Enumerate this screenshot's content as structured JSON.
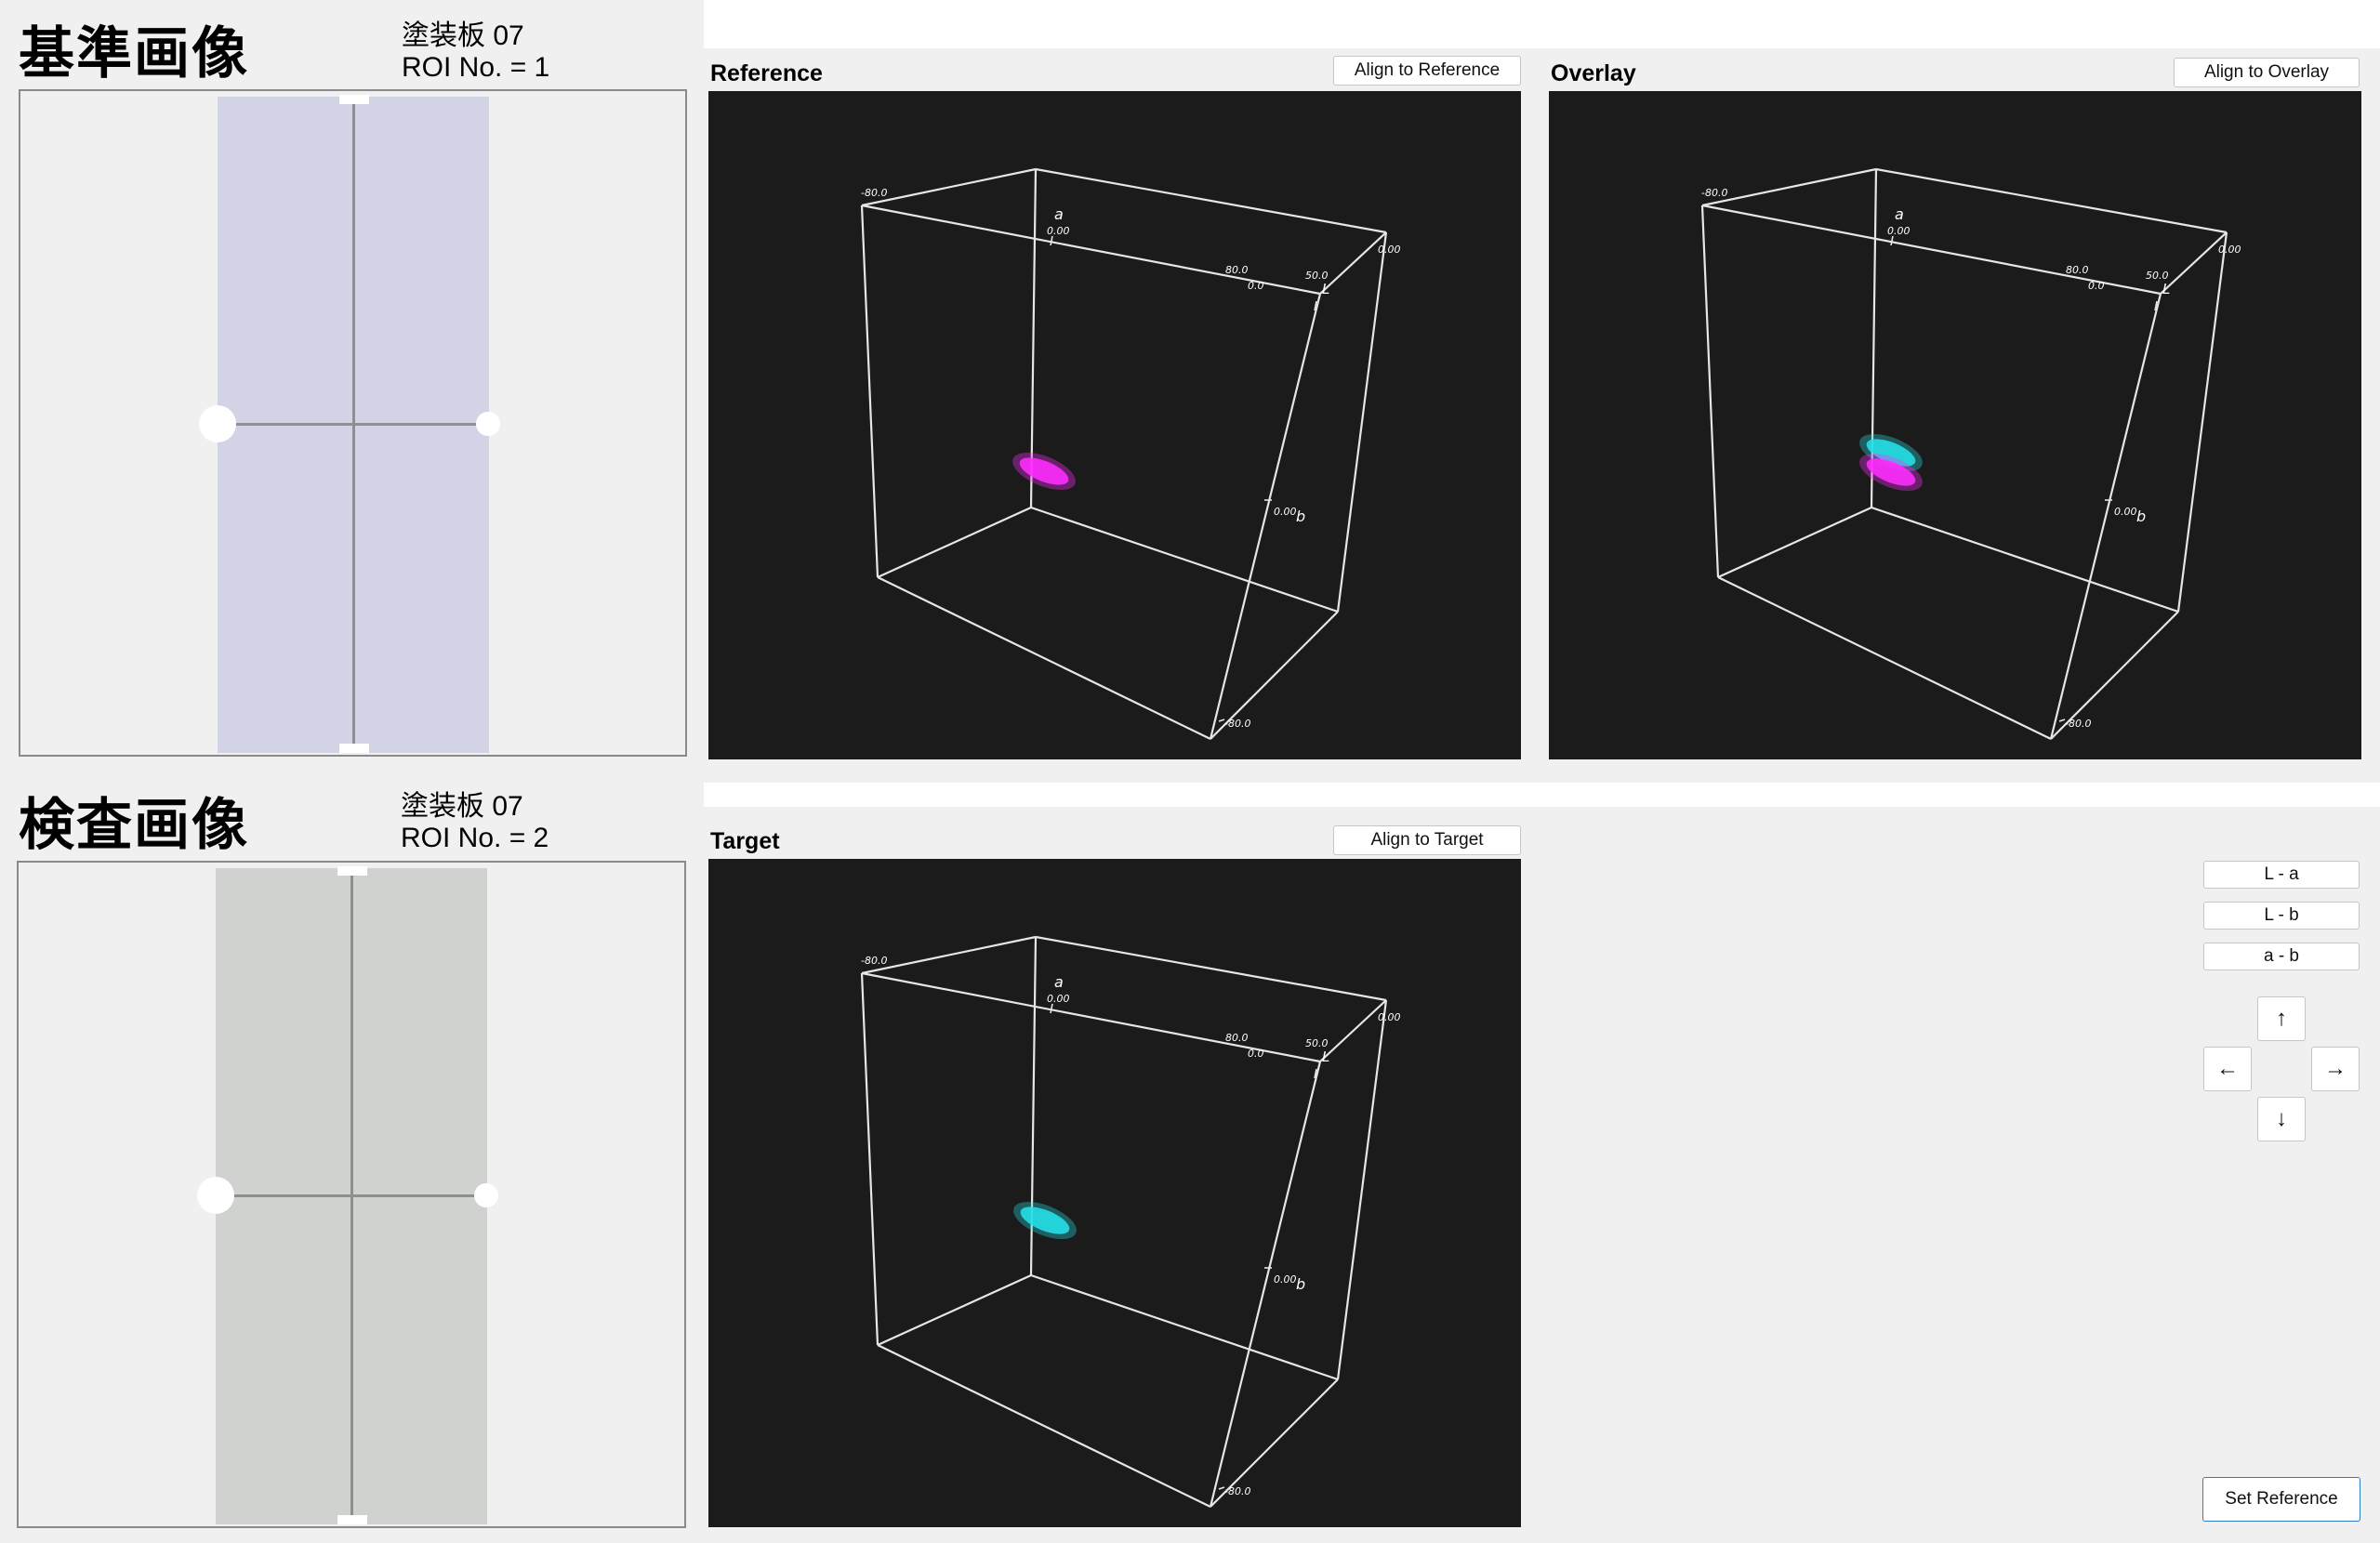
{
  "reference_image": {
    "title": "基準画像",
    "panel_name": "塗装板 07",
    "roi_label": "ROI No. = 1"
  },
  "target_image": {
    "title": "検査画像",
    "panel_name": "塗装板 07",
    "roi_label": "ROI No. = 2"
  },
  "plots": {
    "reference": {
      "title": "Reference",
      "button": "Align to Reference",
      "cluster_colors": [
        "#ff2cff"
      ]
    },
    "overlay": {
      "title": "Overlay",
      "button": "Align to Overlay",
      "cluster_colors": [
        "#25e0e8",
        "#ff2cff"
      ]
    },
    "target": {
      "title": "Target",
      "button": "Align to Target",
      "cluster_colors": [
        "#25e0e8"
      ]
    }
  },
  "axis_labels": {
    "a": "a",
    "b": "b",
    "L": "L",
    "a_tick_min": "-80.0",
    "a_tick_zero": "0.00",
    "a_tick_max": "80.0",
    "L_tick_mid": "50.0",
    "L_tick_max": "0.00",
    "L_tick_min": "0.0",
    "b_tick_zero": "0.00",
    "b_tick_min": "-80.0"
  },
  "view_controls": {
    "plane_buttons": [
      "L - a",
      "L - b",
      "a - b"
    ],
    "arrows": {
      "up": "↑",
      "left": "←",
      "right": "→",
      "down": "↓"
    },
    "set_reference": "Set Reference"
  },
  "colors": {
    "reference_swatch": "#d2d4e6",
    "target_swatch": "#d0d2cf",
    "plot_background": "#1b1b1b",
    "magenta": "#ff2cff",
    "cyan": "#25e0e8"
  }
}
